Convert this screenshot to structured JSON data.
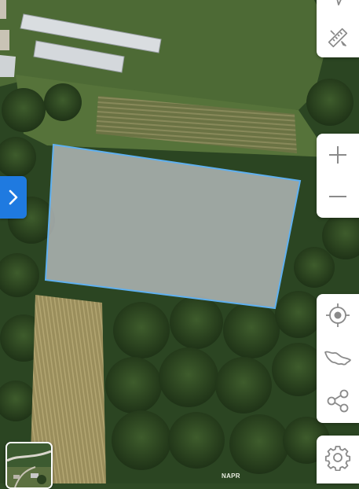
{
  "map": {
    "attribution": "NAPR",
    "parcel_fill": "#c9ccd2",
    "parcel_stroke": "#5fb0f0"
  },
  "controls": {
    "accent": "#1f7ae0",
    "icon_color": "#8a8a8a",
    "top_group": [
      "navigation-arrow-icon",
      "measure-ruler-icon"
    ],
    "zoom_group": [
      "zoom-in-icon",
      "zoom-out-icon"
    ],
    "tools_group": [
      "locate-icon",
      "region-shape-icon",
      "share-icon"
    ],
    "settings_group": [
      "settings-gear-icon"
    ]
  },
  "side_panel": {
    "icon": "chevron-right-icon"
  },
  "layer_switcher": {
    "icon": "basemap-thumbnail"
  }
}
